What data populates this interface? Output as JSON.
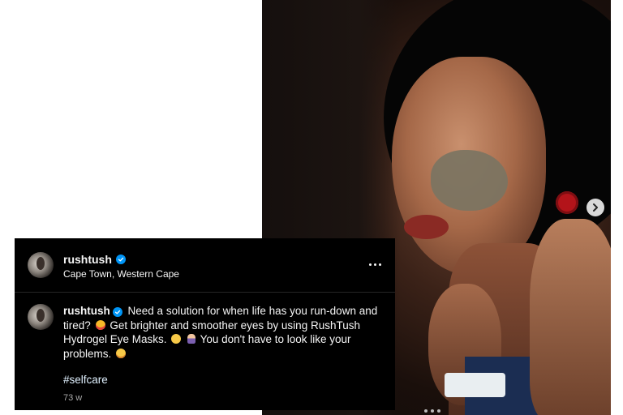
{
  "post": {
    "username": "rushtush",
    "location": "Cape Town, Western Cape",
    "caption_line1": "Need a solution for when life has you run-down and",
    "caption_line2a": "tired?",
    "caption_line2b": "Get brighter and smoother eyes by using RushTush",
    "caption_line3a": "Hydrogel Eye Masks.",
    "caption_line3b": "You don't have to look like your",
    "caption_line4": "problems.",
    "hashtag": "#selfcare",
    "timestamp": "73 w"
  },
  "icons": {
    "verified": "verified-badge-icon",
    "more": "more-options-icon",
    "next": "chevron-right-icon"
  },
  "colors": {
    "card_background": "#000000",
    "verified_blue": "#0095f6",
    "text": "#f5f5f5",
    "muted": "#a8a8a8"
  }
}
